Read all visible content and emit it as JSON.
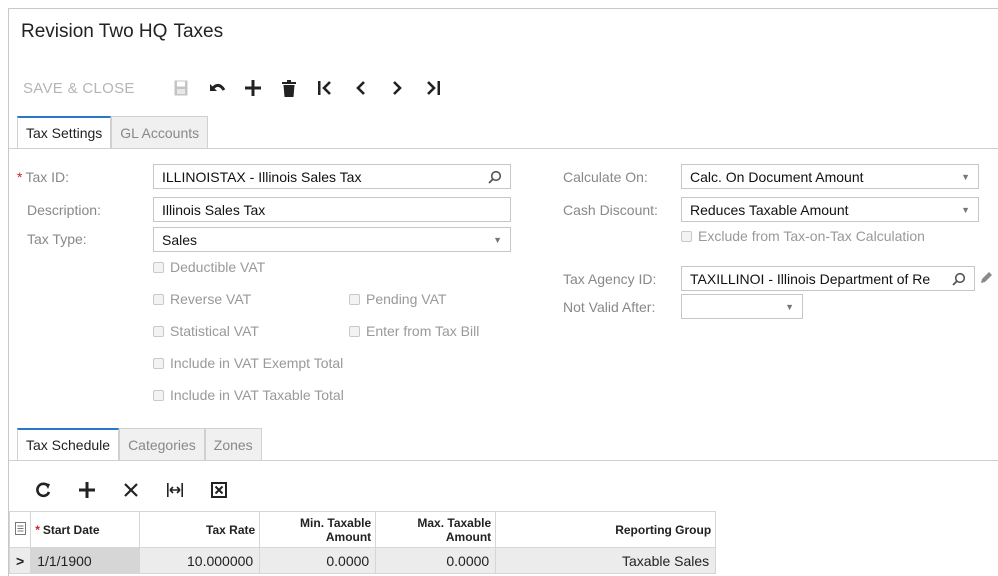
{
  "header": {
    "company": "Revision Two HQ",
    "screen": "Taxes"
  },
  "toolbar": {
    "save_close": "SAVE & CLOSE"
  },
  "tabs": [
    {
      "label": "Tax Settings"
    },
    {
      "label": "GL Accounts"
    }
  ],
  "left": {
    "tax_id": {
      "label": "Tax ID:",
      "required": "*",
      "value": "ILLINOISTAX - Illinois Sales Tax"
    },
    "description": {
      "label": "Description:",
      "value": "Illinois Sales Tax"
    },
    "tax_type": {
      "label": "Tax Type:",
      "value": "Sales"
    },
    "checks": {
      "deductible_vat": "Deductible VAT",
      "reverse_vat": "Reverse VAT",
      "pending_vat": "Pending VAT",
      "statistical_vat": "Statistical VAT",
      "enter_from_tax_bill": "Enter from Tax Bill",
      "include_exempt": "Include in VAT Exempt Total",
      "include_taxable": "Include in VAT Taxable Total"
    }
  },
  "right": {
    "calculate_on": {
      "label": "Calculate On:",
      "value": "Calc. On Document Amount"
    },
    "cash_discount": {
      "label": "Cash Discount:",
      "value": "Reduces Taxable Amount"
    },
    "exclude_tot": "Exclude from Tax-on-Tax Calculation",
    "tax_agency": {
      "label": "Tax Agency ID:",
      "value": "TAXILLINOI - Illinois Department of Re"
    },
    "not_valid_after": {
      "label": "Not Valid After:",
      "value": ""
    }
  },
  "subtabs": [
    {
      "label": "Tax Schedule"
    },
    {
      "label": "Categories"
    },
    {
      "label": "Zones"
    }
  ],
  "grid": {
    "headers": {
      "start_date": "Start Date",
      "start_date_req": "*",
      "tax_rate": "Tax Rate",
      "min_line1": "Min. Taxable",
      "min_line2": "Amount",
      "max_line1": "Max. Taxable",
      "max_line2": "Amount",
      "reporting_group": "Reporting Group"
    },
    "rows": [
      {
        "marker": ">",
        "start_date": "1/1/1900",
        "tax_rate": "10.000000",
        "min_amount": "0.0000",
        "max_amount": "0.0000",
        "reporting_group": "Taxable Sales"
      }
    ]
  },
  "colors": {
    "accent": "#2a77c9",
    "required": "#d02020"
  }
}
